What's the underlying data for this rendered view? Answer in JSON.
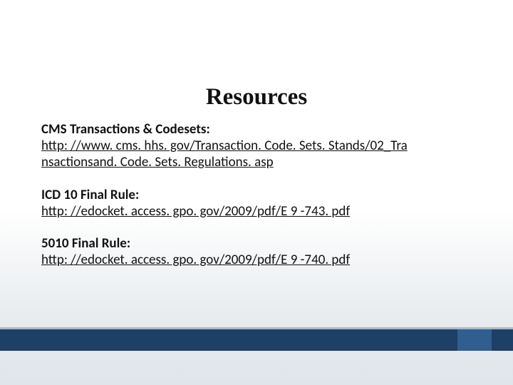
{
  "title": "Resources",
  "items": [
    {
      "label": "CMS Transactions & Codesets:",
      "link_lines": [
        "http: //www. cms. hhs. gov/Transaction. Code. Sets. Stands/02_Tra",
        "nsactionsand. Code. Sets. Regulations. asp"
      ]
    },
    {
      "label": "ICD 10 Final Rule:",
      "link_lines": [
        "http: //edocket. access. gpo. gov/2009/pdf/E 9 -743. pdf"
      ]
    },
    {
      "label": "5010 Final Rule:",
      "link_lines": [
        "http: //edocket. access. gpo. gov/2009/pdf/E 9 -740. pdf"
      ]
    }
  ]
}
